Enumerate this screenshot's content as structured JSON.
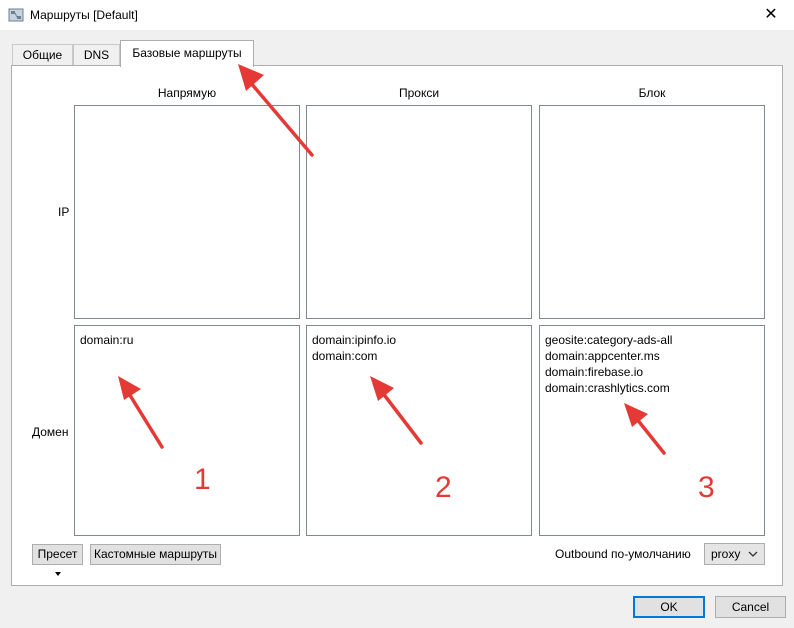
{
  "window": {
    "title": "Маршруты [Default]",
    "close_glyph": "✕"
  },
  "tabs": [
    {
      "label": "Общие"
    },
    {
      "label": "DNS"
    },
    {
      "label": "Базовые маршруты"
    }
  ],
  "grid": {
    "columns": [
      "Напрямую",
      "Прокси",
      "Блок"
    ],
    "rows": [
      "IP",
      "Домен"
    ],
    "ip": {
      "direct": [],
      "proxy": [],
      "block": []
    },
    "domain": {
      "direct": [
        "domain:ru"
      ],
      "proxy": [
        "domain:ipinfo.io",
        "domain:com"
      ],
      "block": [
        "geosite:category-ads-all",
        "domain:appcenter.ms",
        "domain:firebase.io",
        "domain:crashlytics.com"
      ]
    }
  },
  "footer": {
    "preset_label": "Пресет",
    "custom_routes_label": "Кастомные маршруты",
    "outbound_label": "Outbound по-умолчанию",
    "outbound_value": "proxy"
  },
  "dialog": {
    "ok_label": "OK",
    "cancel_label": "Cancel"
  },
  "annotations": {
    "n1": "1",
    "n2": "2",
    "n3": "3",
    "color": "#e53935"
  },
  "icons": {
    "app": "network-routes-icon",
    "close": "close-icon",
    "dropdown": "chevron-down-icon"
  }
}
